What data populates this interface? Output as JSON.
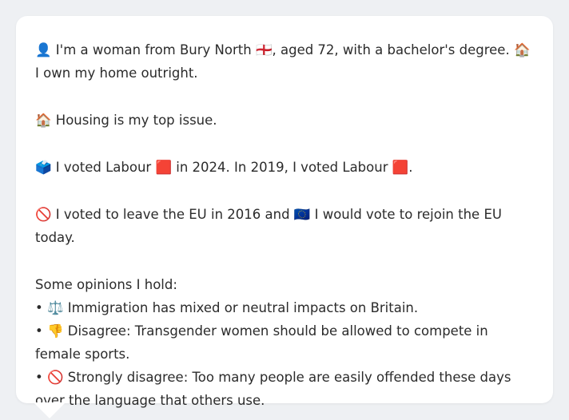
{
  "profile": {
    "intro": "👤 I'm a woman from Bury North 🏴󠁧󠁢󠁥󠁮󠁧󠁿, aged 72, with a bachelor's degree. 🏠 I own my home outright.",
    "top_issue": "🏠 Housing is my top issue.",
    "votes": "🗳️ I voted Labour 🟥 in 2024. In 2019, I voted Labour 🟥.",
    "eu": "🚫 I voted to leave the EU in 2016 and 🇪🇺 I would vote to rejoin the EU today."
  },
  "opinions": {
    "heading": "Some opinions I hold:",
    "items": [
      "• ⚖️ Immigration has mixed or neutral impacts on Britain.",
      "• 👎 Disagree: Transgender women should be allowed to compete in female sports.",
      "• 🚫 Strongly disagree: Too many people are easily offended these days over the language that others use."
    ]
  }
}
